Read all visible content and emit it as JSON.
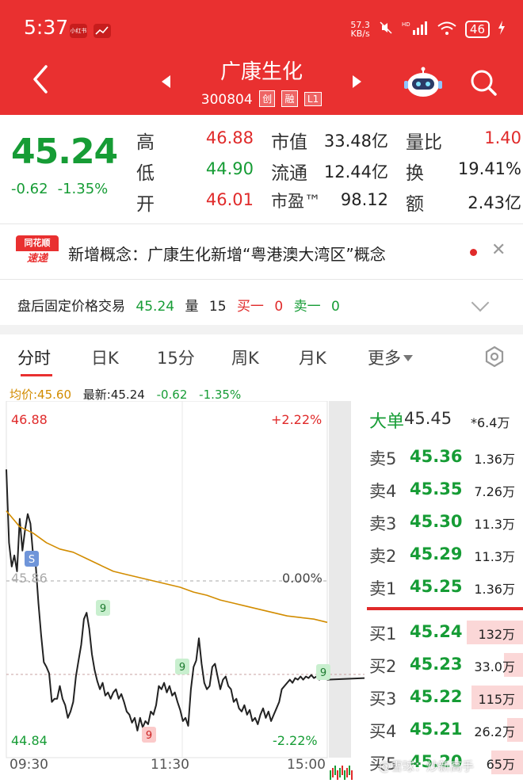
{
  "status_bar": {
    "time": "5:37",
    "app_badge_1": "小红书",
    "net_speed_top": "57.3",
    "net_speed_bottom": "KB/s",
    "signal_text": "HD",
    "battery": "46"
  },
  "header": {
    "stock_name": "广康生化",
    "stock_code": "300804",
    "tags": [
      "创",
      "融",
      "L1"
    ]
  },
  "quote": {
    "price": "45.24",
    "change": "-0.62",
    "change_pct": "-1.35%",
    "high_label": "高",
    "high": "46.88",
    "low_label": "低",
    "low": "44.90",
    "open_label": "开",
    "open": "46.01",
    "mktcap_label": "市值",
    "mktcap": "33.48亿",
    "float_label": "流通",
    "float": "12.44亿",
    "pe_label": "市盈™",
    "pe": "98.12",
    "volratio_label": "量比",
    "volratio": "1.40",
    "turnover_label": "换",
    "turnover": "19.41%",
    "amount_label": "额",
    "amount": "2.43亿"
  },
  "news": {
    "logo_top": "同花顺",
    "logo_bottom": "速递",
    "text": "新增概念：广康生化新增“粤港澳大湾区”概念"
  },
  "after_hours": {
    "label": "盘后固定价格交易",
    "price": "45.24",
    "vol_label": "量",
    "vol": "15",
    "bid1_label": "买一",
    "bid1": "0",
    "ask1_label": "卖一",
    "ask1": "0"
  },
  "tabs": [
    "分时",
    "日K",
    "15分",
    "周K",
    "月K",
    "更多"
  ],
  "avg_line": {
    "avg": "均价:45.60",
    "latest": "最新:45.24",
    "change": "-0.62",
    "change_pct": "-1.35%"
  },
  "chart_data": {
    "type": "line",
    "title": "",
    "ylim": [
      44.84,
      46.88
    ],
    "y_ticks_left": [
      "46.88",
      "45.86",
      "44.84"
    ],
    "y_ticks_right": [
      "+2.22%",
      "0.00%",
      "-2.22%"
    ],
    "x_ticks": [
      "09:30",
      "11:30",
      "15:00"
    ],
    "pre_close": 45.86,
    "series": [
      {
        "name": "",
        "color": "#222222",
        "x": [
          0,
          2,
          4,
          6,
          8,
          10,
          12,
          14,
          16,
          18,
          20,
          22,
          24,
          26,
          28,
          30,
          32,
          34,
          36,
          38,
          40,
          42,
          44,
          46,
          48,
          50,
          52,
          54,
          56,
          58,
          60,
          62,
          64,
          66,
          68,
          70,
          72,
          74,
          76,
          78,
          80,
          82,
          84,
          86,
          88,
          90,
          92,
          94,
          96,
          98,
          100,
          102,
          104,
          106,
          108,
          110,
          112,
          114,
          116,
          118,
          120,
          122,
          124,
          126,
          128,
          130,
          132,
          134,
          136,
          138,
          140,
          142,
          144,
          146,
          148,
          150,
          152,
          154,
          156,
          158,
          160,
          162,
          164,
          166,
          168,
          170,
          172,
          174,
          176,
          178,
          180,
          182,
          184,
          186,
          188,
          190,
          192,
          194,
          196,
          198,
          200,
          202,
          204,
          206,
          208,
          210,
          212,
          214,
          216,
          218,
          220,
          222,
          224,
          226,
          228,
          230,
          232,
          234,
          236,
          238,
          240
        ],
        "values": [
          46.56,
          46.1,
          45.95,
          46.02,
          45.92,
          46.25,
          46.05,
          46.18,
          46.28,
          46.22,
          46.02,
          45.96,
          45.72,
          45.52,
          45.35,
          45.32,
          45.28,
          45.1,
          45.12,
          45.12,
          45.2,
          45.12,
          45.08,
          45.0,
          45.04,
          45.1,
          45.26,
          45.36,
          45.46,
          45.62,
          45.66,
          45.56,
          45.4,
          45.3,
          45.23,
          45.18,
          45.22,
          45.14,
          45.16,
          45.12,
          45.16,
          45.18,
          45.12,
          45.15,
          45.1,
          45.04,
          45.02,
          44.97,
          45.0,
          44.92,
          45.0,
          44.94,
          44.98,
          44.96,
          45.04,
          45.02,
          45.08,
          45.2,
          45.18,
          45.22,
          45.16,
          45.2,
          45.14,
          45.16,
          45.1,
          45.05,
          44.98,
          45.0,
          44.95,
          45.18,
          45.32,
          45.36,
          45.5,
          45.34,
          45.22,
          45.18,
          45.2,
          45.32,
          45.34,
          45.26,
          45.18,
          45.24,
          45.26,
          45.2,
          45.18,
          45.1,
          45.12,
          45.06,
          45.04,
          45.08,
          45.02,
          45.05,
          44.98,
          45.0,
          44.96,
          45.02,
          45.06,
          45.0,
          45.04,
          44.98,
          45.02,
          45.06,
          45.1,
          45.18,
          45.2,
          45.22,
          45.24,
          45.22,
          45.25,
          45.24,
          45.26,
          45.24,
          45.26,
          45.25,
          45.27,
          45.25,
          45.26,
          45.24,
          45.26,
          45.25,
          45.24
        ]
      },
      {
        "name": "均价",
        "color": "#d28c00",
        "x": [
          0,
          10,
          20,
          30,
          40,
          50,
          60,
          70,
          80,
          90,
          100,
          110,
          120,
          130,
          140,
          150,
          160,
          170,
          180,
          190,
          200,
          210,
          220,
          230,
          240
        ],
        "values": [
          46.3,
          46.2,
          46.16,
          46.1,
          46.06,
          46.04,
          46.0,
          45.96,
          45.92,
          45.9,
          45.88,
          45.86,
          45.84,
          45.82,
          45.79,
          45.77,
          45.74,
          45.72,
          45.7,
          45.68,
          45.66,
          45.64,
          45.63,
          45.62,
          45.6
        ]
      }
    ],
    "signal_markers": [
      {
        "label": "S",
        "kind": "buy-signal"
      },
      {
        "label": "9",
        "kind": "green"
      },
      {
        "label": "9",
        "kind": "green"
      },
      {
        "label": "9",
        "kind": "green"
      },
      {
        "label": "9",
        "kind": "red"
      }
    ]
  },
  "order_book": {
    "big_label": "大单",
    "big_price": "45.45",
    "big_vol": "*6.4万",
    "asks": [
      {
        "label": "卖5",
        "price": "45.36",
        "vol": "1.36万"
      },
      {
        "label": "卖4",
        "price": "45.35",
        "vol": "7.26万"
      },
      {
        "label": "卖3",
        "price": "45.30",
        "vol": "11.3万"
      },
      {
        "label": "卖2",
        "price": "45.29",
        "vol": "11.3万"
      },
      {
        "label": "卖1",
        "price": "45.25",
        "vol": "1.36万"
      }
    ],
    "bids": [
      {
        "label": "买1",
        "price": "45.24",
        "vol": "132万",
        "fill": 0.36
      },
      {
        "label": "买2",
        "price": "45.23",
        "vol": "33.0万",
        "fill": 0.12
      },
      {
        "label": "买3",
        "price": "45.22",
        "vol": "115万",
        "fill": 0.33
      },
      {
        "label": "买4",
        "price": "45.21",
        "vol": "26.2万",
        "fill": 0.1
      },
      {
        "label": "买5",
        "price": "45.20",
        "vol": "65万",
        "fill": 0.2
      }
    ]
  },
  "watermark": "@雪球：炒新高手"
}
